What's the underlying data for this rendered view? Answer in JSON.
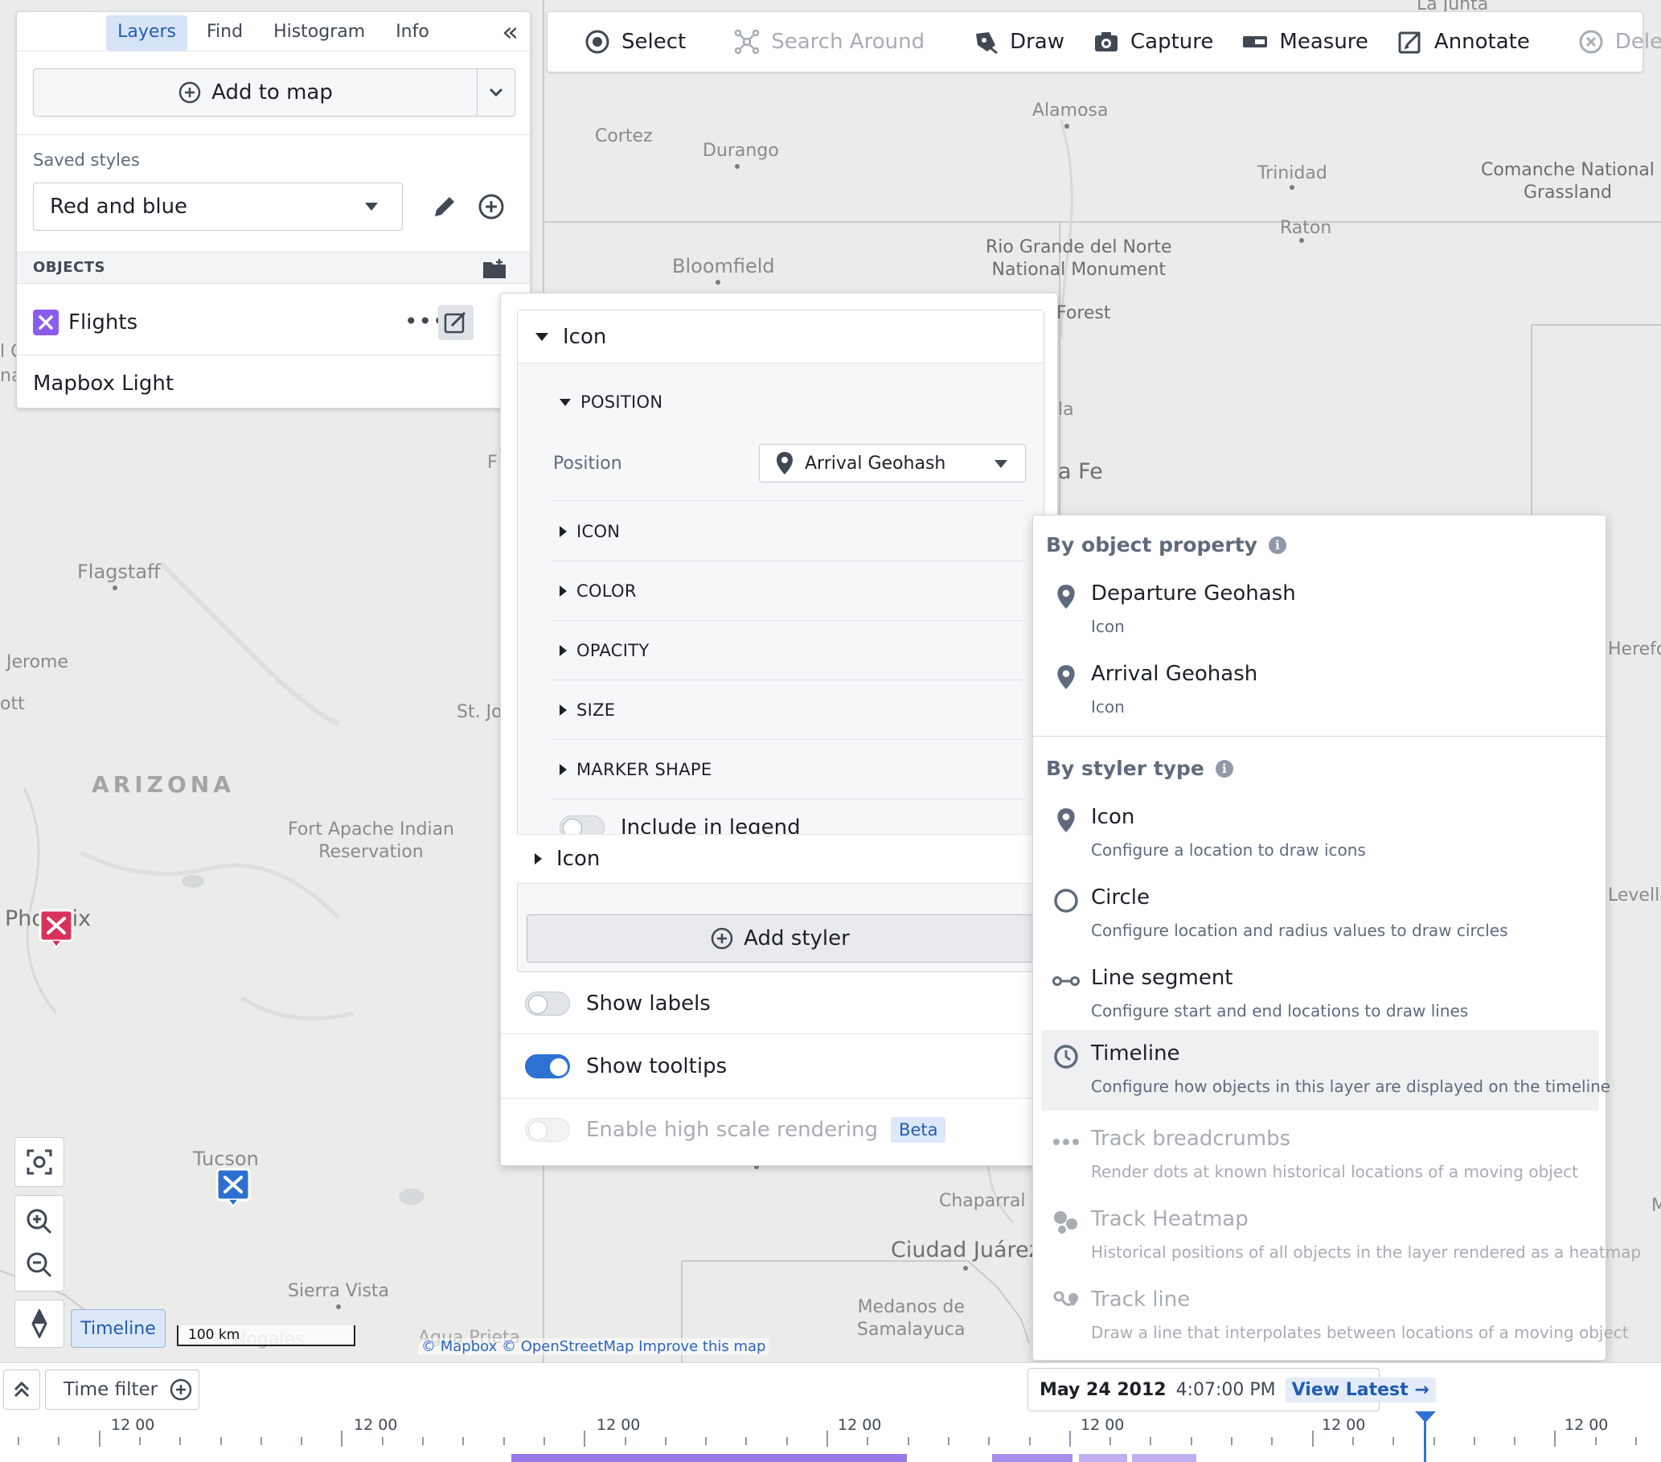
{
  "toolbar": {
    "select": "Select",
    "search_around": "Search Around",
    "draw": "Draw",
    "capture": "Capture",
    "measure": "Measure",
    "annotate": "Annotate",
    "delete": "Delete"
  },
  "left_panel": {
    "tabs": [
      "Layers",
      "Find",
      "Histogram",
      "Info"
    ],
    "add_to_map": "Add to map",
    "saved_styles_label": "Saved styles",
    "saved_style_value": "Red and blue",
    "objects_header": "OBJECTS",
    "layers": [
      {
        "name": "Flights"
      },
      {
        "name": "Mapbox Light"
      }
    ]
  },
  "styler": {
    "icon_header": "Icon",
    "position_section": "POSITION",
    "position_label": "Position",
    "position_value": "Arrival Geohash",
    "sections": [
      "ICON",
      "COLOR",
      "OPACITY",
      "SIZE",
      "MARKER SHAPE"
    ],
    "include_in_legend": "Include in legend",
    "icon_header_2": "Icon",
    "add_styler": "Add styler",
    "show_labels": "Show labels",
    "show_tooltips": "Show tooltips",
    "high_scale": "Enable high scale rendering",
    "beta": "Beta"
  },
  "menu": {
    "by_property": "By object property",
    "property_items": [
      {
        "title": "Departure Geohash",
        "desc": "Icon"
      },
      {
        "title": "Arrival Geohash",
        "desc": "Icon"
      }
    ],
    "by_styler": "By styler type",
    "styler_items": [
      {
        "title": "Icon",
        "desc": "Configure a location to draw icons"
      },
      {
        "title": "Circle",
        "desc": "Configure location and radius values to draw circles"
      },
      {
        "title": "Line segment",
        "desc": "Configure start and end locations to draw lines"
      },
      {
        "title": "Timeline",
        "desc": "Configure how objects in this layer are displayed on the timeline"
      },
      {
        "title": "Track breadcrumbs",
        "desc": "Render dots at known historical locations of a moving object"
      },
      {
        "title": "Track Heatmap",
        "desc": "Historical positions of all objects in the layer rendered as a heatmap"
      },
      {
        "title": "Track line",
        "desc": "Draw a line that interpolates between locations of a moving object"
      }
    ]
  },
  "map": {
    "places": {
      "la_junta": "La Junta",
      "alamosa": "Alamosa",
      "cortez": "Cortez",
      "durango": "Durango",
      "trinidad": "Trinidad",
      "comanche": "Comanche National\nGrassland",
      "raton": "Raton",
      "rio_grande": "Rio Grande del Norte\nNational Monument",
      "bloomfield": "Bloomfield",
      "forest": "Forest",
      "la": "la",
      "a_fe": "a Fe",
      "f": "F",
      "flagstaff": "Flagstaff",
      "jerome": "Jerome",
      "ott": "ott",
      "st_jo": "St. Jo",
      "arizona": "ARIZONA",
      "fort_apache": "Fort Apache Indian\nReservation",
      "phoenix": "Phoenix",
      "tucson": "Tucson",
      "sierra_vista": "Sierra Vista",
      "nogales": "Nogales",
      "agua_prieta": "Agua Prieta",
      "chaparral": "Chaparral",
      "ciudad_juarez": "Ciudad Juárez",
      "medanos": "Medanos de\nSamalayuca",
      "hereford": "Herefor",
      "levelland": "Levellar",
      "m": "M",
      "left_o": "l C",
      "left_na": "na"
    },
    "attribution": "© Mapbox © OpenStreetMap Improve this map",
    "scale": "100 km",
    "timeline_button": "Timeline"
  },
  "timebar": {
    "time_filter": "Time filter",
    "date": "May 24 2012",
    "time": "4:07:00 PM",
    "view_latest": "View Latest →",
    "tick_labels": [
      "12 00",
      "12 00",
      "12 00",
      "12 00",
      "12 00",
      "12 00",
      "12 00"
    ]
  },
  "colors": {
    "accent": "#2d72d2",
    "flights_icon": "#8c5cf0",
    "marker_red": "#d9325a",
    "marker_blue": "#2c6fd1",
    "histogram": "#9779e8"
  }
}
